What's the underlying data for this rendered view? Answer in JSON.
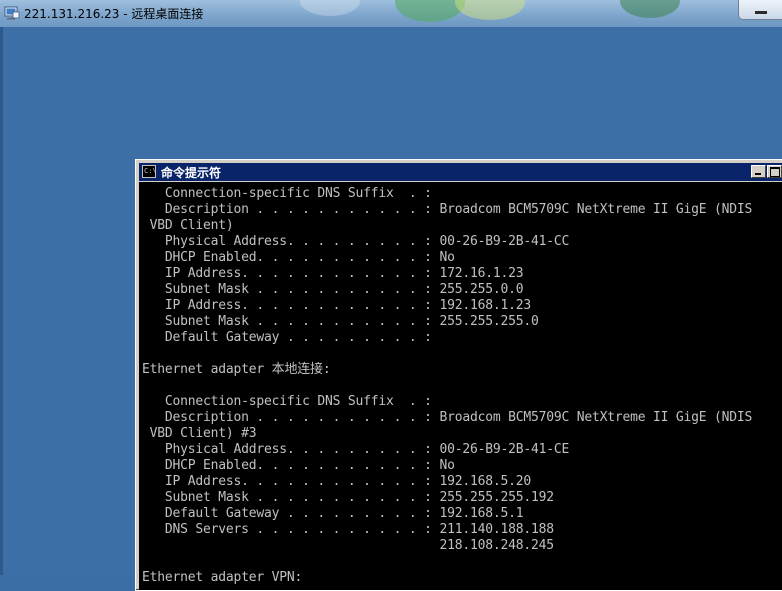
{
  "rdp": {
    "title": "221.131.216.23 - 远程桌面连接",
    "icon": "remote-desktop-icon"
  },
  "cmd": {
    "title": "命令提示符",
    "icon": "cmd-icon",
    "icon_text": "C:\\",
    "lines": [
      "   Connection-specific DNS Suffix  . :",
      "   Description . . . . . . . . . . . : Broadcom BCM5709C NetXtreme II GigE (NDIS",
      " VBD Client)",
      "   Physical Address. . . . . . . . . : 00-26-B9-2B-41-CC",
      "   DHCP Enabled. . . . . . . . . . . : No",
      "   IP Address. . . . . . . . . . . . : 172.16.1.23",
      "   Subnet Mask . . . . . . . . . . . : 255.255.0.0",
      "   IP Address. . . . . . . . . . . . : 192.168.1.23",
      "   Subnet Mask . . . . . . . . . . . : 255.255.255.0",
      "   Default Gateway . . . . . . . . . :",
      "",
      "Ethernet adapter 本地连接:",
      "",
      "   Connection-specific DNS Suffix  . :",
      "   Description . . . . . . . . . . . : Broadcom BCM5709C NetXtreme II GigE (NDIS",
      " VBD Client) #3",
      "   Physical Address. . . . . . . . . : 00-26-B9-2B-41-CE",
      "   DHCP Enabled. . . . . . . . . . . : No",
      "   IP Address. . . . . . . . . . . . : 192.168.5.20",
      "   Subnet Mask . . . . . . . . . . . : 255.255.255.192",
      "   Default Gateway . . . . . . . . . : 192.168.5.1",
      "   DNS Servers . . . . . . . . . . . : 211.140.188.188",
      "                                       218.108.248.245",
      "",
      "Ethernet adapter VPN:"
    ]
  }
}
